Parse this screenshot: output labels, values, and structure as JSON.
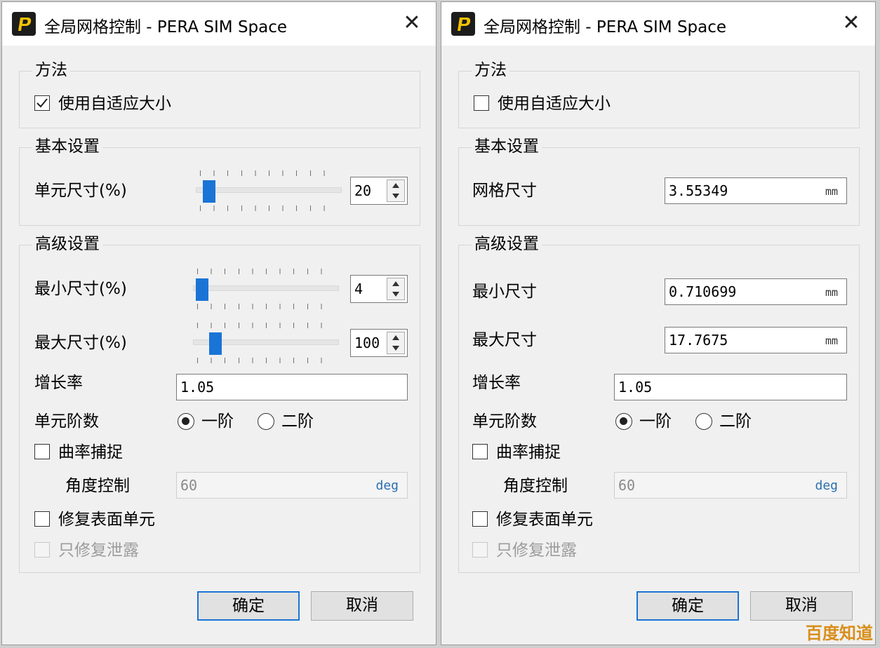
{
  "window_title": "全局网格控制 - PERA SIM Space",
  "close_glyph": "✕",
  "groups": {
    "method": "方法",
    "basic": "基本设置",
    "advanced": "高级设置"
  },
  "adaptive_label": "使用自适应大小",
  "left": {
    "adaptive_checked": true,
    "element_size_label": "单元尺寸(%)",
    "element_size_value": "20",
    "element_size_fraction": 0.05,
    "min_size_label": "最小尺寸(%)",
    "min_size_value": "4",
    "min_size_fraction": 0.02,
    "max_size_label": "最大尺寸(%)",
    "max_size_value": "100",
    "max_size_fraction": 0.12
  },
  "right": {
    "adaptive_checked": false,
    "mesh_size_label": "网格尺寸",
    "mesh_size_value": "3.55349",
    "min_size_label": "最小尺寸",
    "min_size_value": "0.710699",
    "max_size_label": "最大尺寸",
    "max_size_value": "17.7675",
    "unit_mm": "mm"
  },
  "growth_rate_label": "增长率",
  "growth_rate_value": "1.05",
  "element_order_label": "单元阶数",
  "order_first": "一阶",
  "order_second": "二阶",
  "order_selected": "first",
  "curvature_label": "曲率捕捉",
  "angle_label": "角度控制",
  "angle_value": "60",
  "angle_unit": "deg",
  "repair_surface_label": "修复表面单元",
  "repair_leak_label": "只修复泄露",
  "ok_label": "确定",
  "cancel_label": "取消",
  "watermark": "百度知道",
  "colors": {
    "accent": "#1a74d6",
    "logo_bg": "#1c1c1c",
    "logo_fg": "#f2c200",
    "watermark": "#d98e1a"
  }
}
